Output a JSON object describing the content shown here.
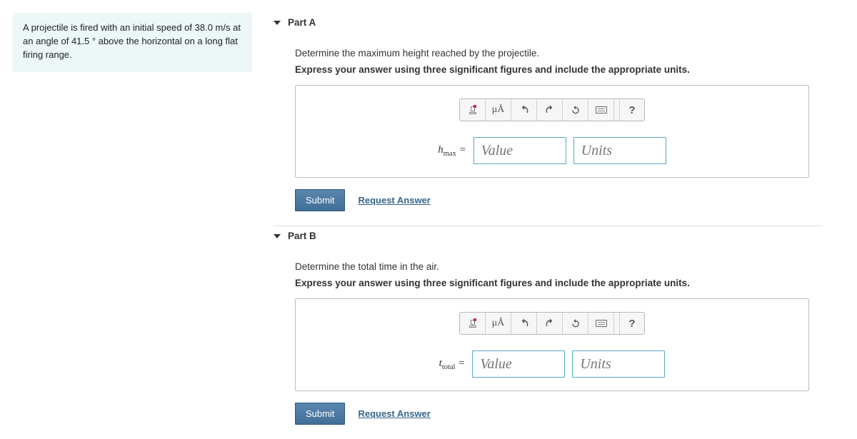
{
  "problem_text": "A projectile is fired with an initial speed of 38.0 m/s at an angle of 41.5 ° above the horizontal on a long flat firing range.",
  "partA": {
    "title": "Part A",
    "question": "Determine the maximum height reached by the projectile.",
    "instruction": "Express your answer using three significant figures and include the appropriate units.",
    "var_base": "h",
    "var_sub": "max",
    "value_placeholder": "Value",
    "units_placeholder": "Units",
    "submit_label": "Submit",
    "request_label": "Request Answer",
    "mu_label": "μÅ",
    "help_label": "?"
  },
  "partB": {
    "title": "Part B",
    "question": "Determine the total time in the air.",
    "instruction": "Express your answer using three significant figures and include the appropriate units.",
    "var_base": "t",
    "var_sub": "total",
    "value_placeholder": "Value",
    "units_placeholder": "Units",
    "submit_label": "Submit",
    "request_label": "Request Answer",
    "mu_label": "μÅ",
    "help_label": "?"
  }
}
